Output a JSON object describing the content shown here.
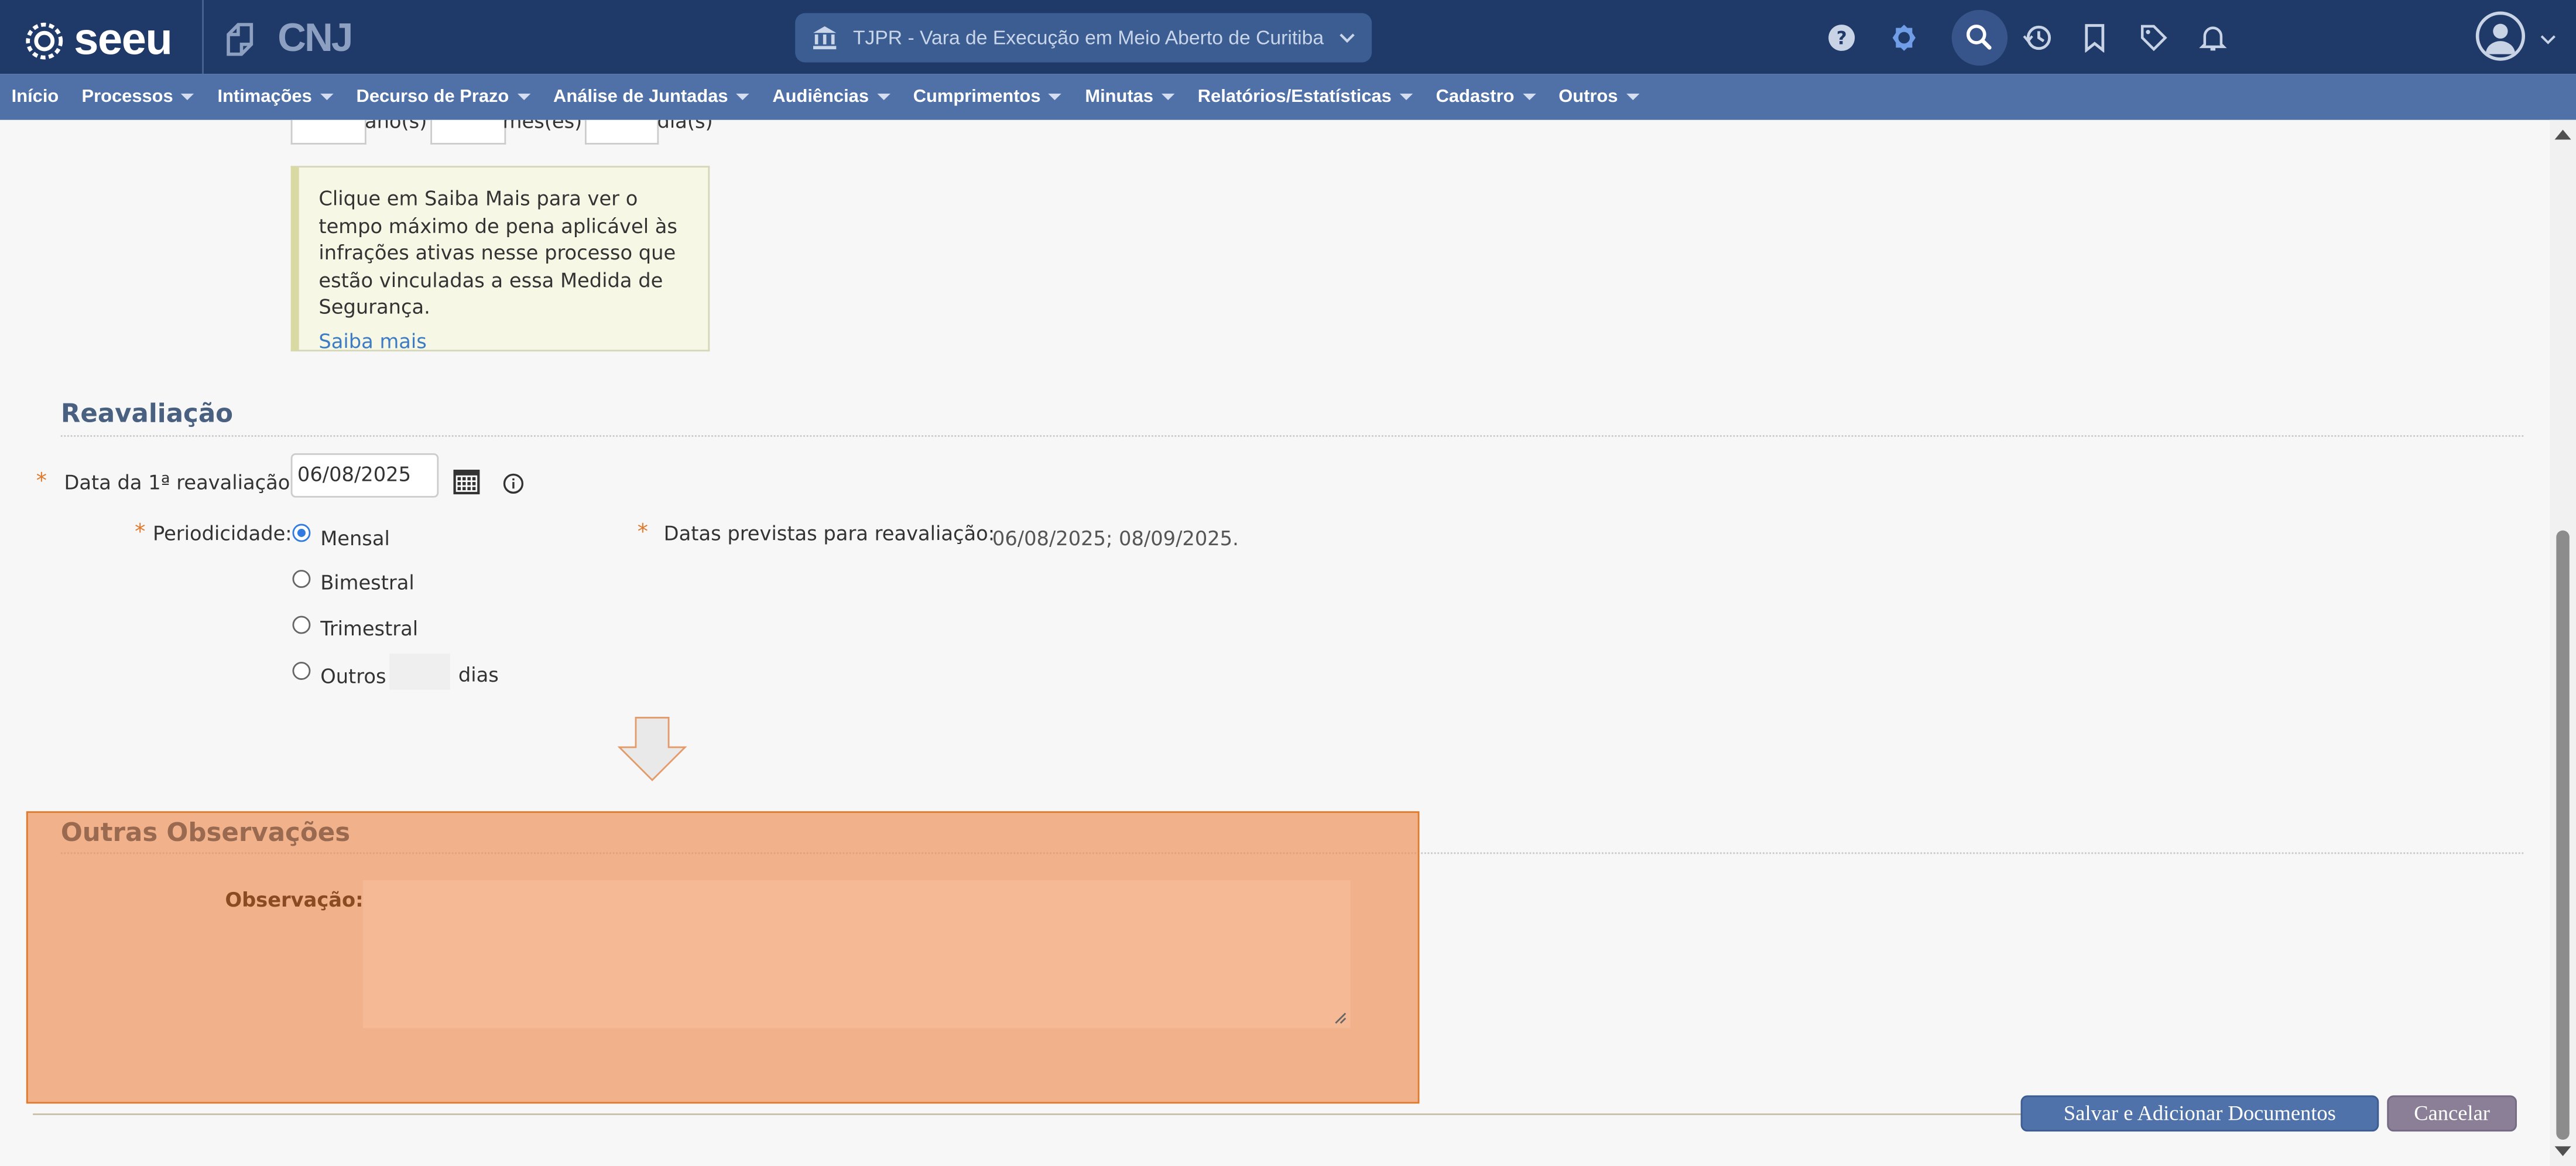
{
  "header": {
    "logo_text": "seeu",
    "logo2_text": "CNJ",
    "court_selector": "TJPR - Vara de Execução em Meio Aberto de Curitiba",
    "icons": [
      "help-icon",
      "theme-icon",
      "search-icon",
      "history-icon",
      "bookmark-icon",
      "tag-icon",
      "bell-icon",
      "user-icon"
    ]
  },
  "menu": {
    "items": [
      {
        "label": "Início",
        "dropdown": false
      },
      {
        "label": "Processos",
        "dropdown": true
      },
      {
        "label": "Intimações",
        "dropdown": true
      },
      {
        "label": "Decurso de Prazo",
        "dropdown": true
      },
      {
        "label": "Análise de Juntadas",
        "dropdown": true
      },
      {
        "label": "Audiências",
        "dropdown": true
      },
      {
        "label": "Cumprimentos",
        "dropdown": true
      },
      {
        "label": "Minutas",
        "dropdown": true
      },
      {
        "label": "Relatórios/Estatísticas",
        "dropdown": true
      },
      {
        "label": "Cadastro",
        "dropdown": true
      },
      {
        "label": "Outros",
        "dropdown": true
      }
    ]
  },
  "duration": {
    "years_unit": "ano(s)",
    "months_unit": "mês(es)",
    "days_unit": "dia(s)"
  },
  "info_box": {
    "text": "Clique em Saiba Mais para ver o tempo máximo de pena aplicável às infrações ativas nesse processo que estão vinculadas a essa Medida de Segurança.",
    "link": "Saiba mais"
  },
  "reavaliacao": {
    "title": "Reavaliação",
    "first_date_label": "Data da 1ª reavaliação:",
    "first_date_value": "06/08/2025",
    "periodicity_label": "Periodicidade:",
    "options": [
      "Mensal",
      "Bimestral",
      "Trimestral",
      "Outros"
    ],
    "selected": "Mensal",
    "days_suffix": "dias",
    "scheduled_label": "Datas previstas para reavaliação:",
    "scheduled_value": "06/08/2025; 08/09/2025."
  },
  "observacoes": {
    "title": "Outras Observações",
    "label": "Observação:",
    "value": ""
  },
  "actions": {
    "save": "Salvar e Adicionar Documentos",
    "cancel": "Cancelar"
  },
  "colors": {
    "topbar": "#1f3a68",
    "menubar": "#4f71a8",
    "highlight": "#ee8c50",
    "required": "#e07b2e"
  }
}
